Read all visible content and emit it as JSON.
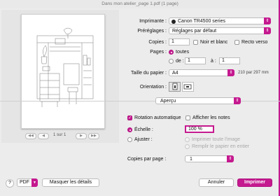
{
  "window": {
    "title": "Dans mon atelier_page 1.pdf (1 page)"
  },
  "preview": {
    "page_indicator": "1 sur 1",
    "first": "◀◀",
    "prev": "◀",
    "next": "▶",
    "last": "▶▶"
  },
  "printer": {
    "label": "Imprimante :",
    "value": "Canon TR4500 series"
  },
  "presets": {
    "label": "Préréglages :",
    "value": "Réglages par défaut"
  },
  "copies": {
    "label": "Copies :",
    "value": "1",
    "bw_label": "Noir et blanc",
    "duplex_label": "Recto verso"
  },
  "pages": {
    "label": "Pages :",
    "all_label": "toutes",
    "from_label": "de :",
    "from_value": "1",
    "to_label": "à :",
    "to_value": "1"
  },
  "paper": {
    "label": "Taille du papier :",
    "value": "A4",
    "dimensions": "210 par 297 mm"
  },
  "orientation": {
    "label": "Orientation :"
  },
  "section": {
    "value": "Aperçu"
  },
  "options": {
    "auto_rotate_label": "Rotation automatique",
    "show_notes_label": "Afficher les notes",
    "scale_label": "Échelle :",
    "scale_value": "100 %",
    "fit_label": "Ajuster :",
    "print_entire_label": "Imprimer toute l'image",
    "fill_paper_label": "Remplir le papier en entier",
    "copies_per_page_label": "Copies par page :",
    "copies_per_page_value": "1"
  },
  "footer": {
    "help": "?",
    "pdf": "PDF",
    "hide_details": "Masquer les détails",
    "cancel": "Annuler",
    "print": "Imprimer"
  },
  "colors": {
    "accent": "#c5198f"
  }
}
